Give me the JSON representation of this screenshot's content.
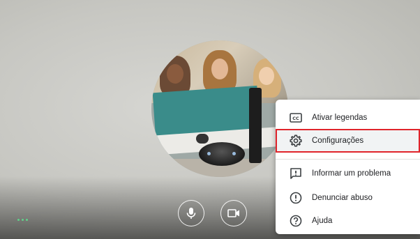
{
  "menu": {
    "items": [
      {
        "label": "Ativar legendas",
        "icon": "closed-captions-icon"
      },
      {
        "label": "Configurações",
        "icon": "gear-icon",
        "highlighted": true
      },
      {
        "label": "Informar um problema",
        "icon": "report-problem-icon"
      },
      {
        "label": "Denunciar abuso",
        "icon": "warning-circle-icon"
      },
      {
        "label": "Ajuda",
        "icon": "help-circle-icon"
      }
    ],
    "highlight_color": "#e0242b"
  },
  "controls": {
    "mic_icon": "microphone-icon",
    "camera_icon": "camera-icon",
    "more_icon": "more-dots-icon",
    "accent": "#5fd38a"
  }
}
